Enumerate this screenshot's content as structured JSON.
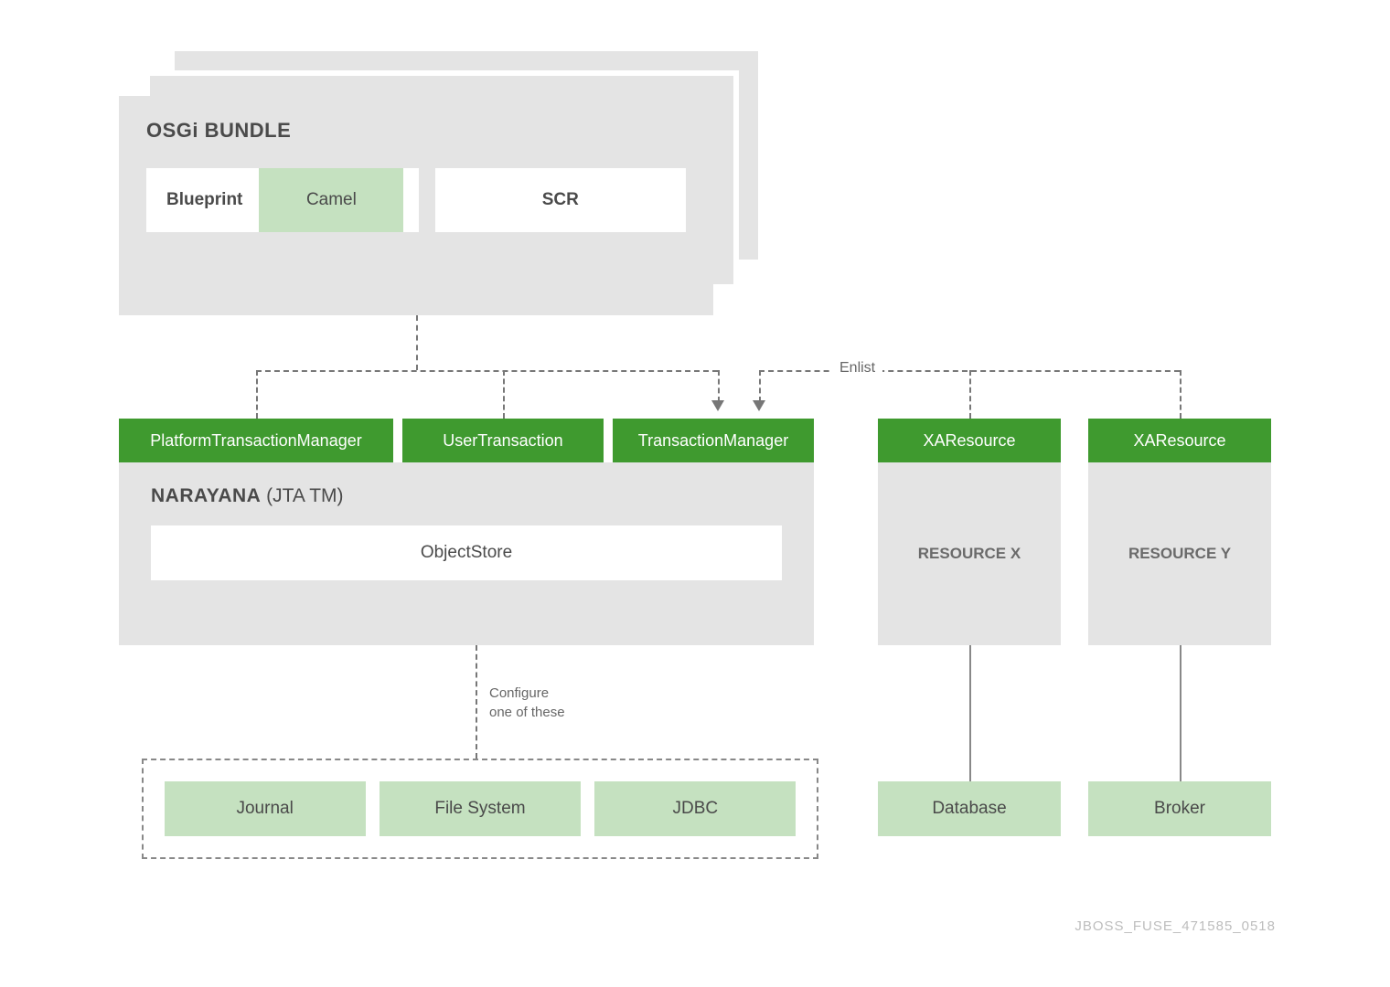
{
  "osgi": {
    "title": "OSGi BUNDLE",
    "blueprint": "Blueprint",
    "camel": "Camel",
    "scr": "SCR"
  },
  "green_headers": {
    "ptm": "PlatformTransactionManager",
    "ut": "UserTransaction",
    "tm": "TransactionManager",
    "xa1": "XAResource",
    "xa2": "XAResource"
  },
  "narayana": {
    "title_bold": "NARAYANA",
    "title_rest": " (JTA TM)",
    "objectstore": "ObjectStore"
  },
  "resources": {
    "x": "RESOURCE X",
    "y": "RESOURCE Y"
  },
  "store_options": [
    "Journal",
    "File System",
    "JDBC"
  ],
  "backends": {
    "database": "Database",
    "broker": "Broker"
  },
  "labels": {
    "enlist": "Enlist",
    "configure1": "Configure",
    "configure2": "one of these"
  },
  "footer": "JBOSS_FUSE_471585_0518"
}
